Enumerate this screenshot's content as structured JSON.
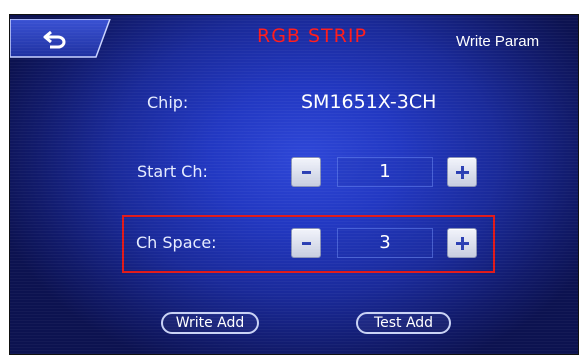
{
  "header": {
    "title": "RGB STRIP",
    "write_param_label": "Write Param",
    "back_icon": "return-arrow-icon"
  },
  "settings": {
    "chip": {
      "label": "Chip:",
      "value": "SM1651X-3CH"
    },
    "start_ch": {
      "label": "Start Ch:",
      "value": "1"
    },
    "ch_space": {
      "label": "Ch Space:",
      "value": "3"
    }
  },
  "actions": {
    "write_add_label": "Write Add",
    "test_add_label": "Test Add"
  },
  "colors": {
    "title": "#ff1a1a",
    "highlight": "#e01818",
    "background": "#2238c2"
  }
}
